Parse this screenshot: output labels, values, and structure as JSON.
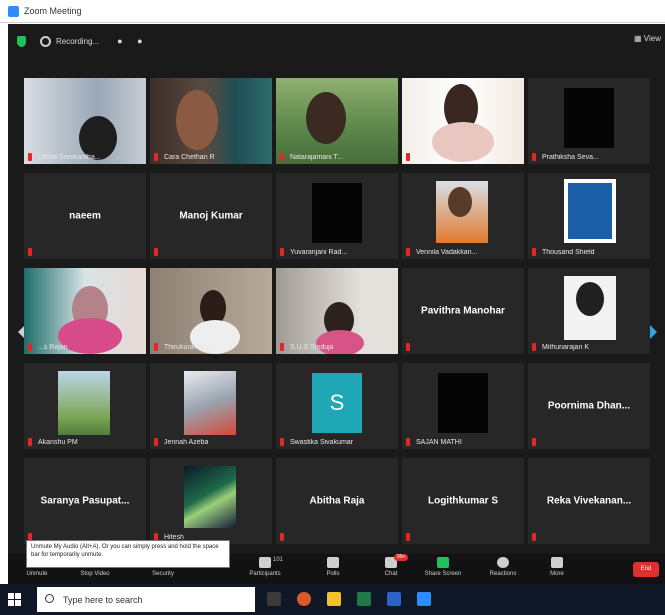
{
  "window": {
    "title": "Zoom Meeting"
  },
  "topbar": {
    "recording_label": "Recording...",
    "view_label": "View"
  },
  "participants": [
    {
      "name": "Lohita Sreekantha...",
      "kind": "photo"
    },
    {
      "name": "Cara Chethan R",
      "kind": "photo"
    },
    {
      "name": "Natarajamani T...",
      "kind": "photo",
      "active": true
    },
    {
      "name": "",
      "kind": "photo"
    },
    {
      "name": "Prathiksha Seva...",
      "kind": "black"
    },
    {
      "name": "",
      "display": "naeem",
      "kind": "text"
    },
    {
      "name": "",
      "display": "Manoj Kumar",
      "kind": "text"
    },
    {
      "name": "Yuvaranjani Rad...",
      "kind": "black"
    },
    {
      "name": "Vennila Vadakkan...",
      "kind": "photo"
    },
    {
      "name": "Thousand Shield",
      "kind": "photo"
    },
    {
      "name": "...s Rajan",
      "kind": "photo"
    },
    {
      "name": "Thirukural Rend...",
      "kind": "photo"
    },
    {
      "name": "S.U.S Sinduja",
      "kind": "photo"
    },
    {
      "name": "",
      "display": "Pavithra Manohar",
      "kind": "text"
    },
    {
      "name": "Mithunarajan K",
      "kind": "photo"
    },
    {
      "name": "Akanshu PM",
      "kind": "photo"
    },
    {
      "name": "Jennah Azeba",
      "kind": "photo"
    },
    {
      "name": "Swastika Sivakumar",
      "kind": "avatar",
      "initial": "S"
    },
    {
      "name": "SAJAN MATHI",
      "kind": "black"
    },
    {
      "name": "",
      "display": "Poornima Dhan...",
      "kind": "text"
    },
    {
      "name": "",
      "display": "Saranya Pasupat...",
      "kind": "text"
    },
    {
      "name": "Hitesh",
      "kind": "photo"
    },
    {
      "name": "",
      "display": "Abitha Raja",
      "kind": "text"
    },
    {
      "name": "",
      "display": "Logithkumar S",
      "kind": "text"
    },
    {
      "name": "",
      "display": "Reka Vivekanan...",
      "kind": "text"
    }
  ],
  "toolbar": {
    "items": [
      {
        "label": "Unmute",
        "icon": "microphone-icon"
      },
      {
        "label": "Stop Video",
        "icon": "video-icon"
      },
      {
        "label": "Security",
        "icon": "shield-icon"
      },
      {
        "label": "Participants",
        "icon": "participants-icon",
        "count": "101"
      },
      {
        "label": "Polls",
        "icon": "polls-icon"
      },
      {
        "label": "Chat",
        "icon": "chat-icon",
        "badge": "99+"
      },
      {
        "label": "Share Screen",
        "icon": "share-screen-icon"
      },
      {
        "label": "Reactions",
        "icon": "reactions-icon"
      },
      {
        "label": "More",
        "icon": "more-icon"
      }
    ],
    "end_label": "End",
    "tooltip": "Unmute My Audio (Alt+A). Or you can simply press and hold the space bar for temporarily unmute."
  },
  "taskbar": {
    "search_placeholder": "Type here to search"
  },
  "colors": {
    "meeting_bg": "#1a1a1a",
    "tile_bg": "#272727",
    "active_speaker": "#b8d640",
    "mic_muted": "#e02828",
    "share_green": "#20c05c",
    "end_red": "#e0302e",
    "taskbar_bg": "#101828"
  }
}
